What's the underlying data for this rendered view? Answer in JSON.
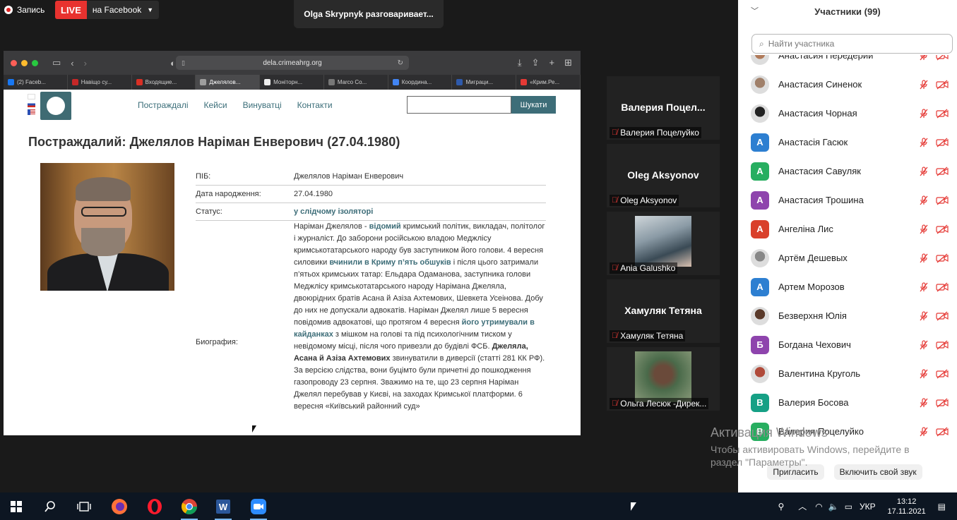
{
  "zoom": {
    "recording_label": "Запись",
    "live_label": "LIVE",
    "live_target": "на Facebook",
    "active_speaker": "Olga Skrypnyk разговаривает..."
  },
  "browser": {
    "url": "dela.crimeahrg.org",
    "tabs": [
      {
        "label": "(2) Faceb...",
        "color": "#1877f2"
      },
      {
        "label": "Навіщо су...",
        "color": "#c62828"
      },
      {
        "label": "Входящие...",
        "color": "#d93025"
      },
      {
        "label": "Джелялов...",
        "color": "#9e9e9e"
      },
      {
        "label": "Моніторн...",
        "color": "#eeeeee"
      },
      {
        "label": "Marco Co...",
        "color": "#777777"
      },
      {
        "label": "Координа...",
        "color": "#4285f4"
      },
      {
        "label": "Миграци...",
        "color": "#2e5aac"
      },
      {
        "label": "«Крим.Ре...",
        "color": "#e53935"
      }
    ]
  },
  "site": {
    "nav": [
      "Постраждалі",
      "Кейси",
      "Винуватці",
      "Контакти"
    ],
    "search_button": "Шукати",
    "heading": "Постраждалий: Джелялов Наріман Енверович (27.04.1980)",
    "fields": [
      {
        "label": "ПІБ:",
        "value": "Джелялов Наріман Енверович"
      },
      {
        "label": "Дата народження:",
        "value": "27.04.1980"
      },
      {
        "label": "Статус:",
        "value": "у слідчому ізоляторі"
      }
    ],
    "bio_label": "Биография:",
    "bio": {
      "p1": "Наріман Джелялов - ",
      "link1": "відомий",
      "p2": " кримський політик, викладач, політолог і журналіст. До заборони російською владою Меджлісу кримськотатарського народу був заступником його голови. 4 вересня силовики ",
      "link2": "вчинили в Криму п’ять обшуків",
      "p3": " і після цього затримали п’ятьох кримських татар: Ельдара Одаманова, заступника голови Меджлісу кримськотатарського народу Нарімана Джеляла, двоюрідних братів Асана й Азіза Ахтемових, Шевкета Усеінова. Добу до них не допускали адвокатів. Наріман Джелял лише 5 вересня повідомив адвокатові, що протягом 4 вересня ",
      "link3": "його утримували в кайданках",
      "p4": " з мішком на голові та під психологічним тиском у невідомому місці, після чого привезли до будівлі ФСБ. ",
      "bold1": "Джеляла, Асана й Азіза Ахтемових",
      "p5": " звинуватили в диверсії (статті 281 КК РФ). За версією слідства, вони буцімто були причетні до пошкодження газопроводу 23 серпня. Зважимо на те, що 23 серпня Наріман Джелял перебував у Києві, на заходах Кримської платформи. 6 вересня «Київський районний суд»"
    }
  },
  "tiles": [
    {
      "big": "Валерия  Поцел...",
      "tag": "Валерия Поцелуйко",
      "has_video": false
    },
    {
      "big": "Oleg Aksyonov",
      "tag": "Oleg Aksyonov",
      "has_video": false
    },
    {
      "big": "",
      "tag": "Ania Galushko",
      "has_video": true
    },
    {
      "big": "Хамуляк Тетяна",
      "tag": "Хамуляк Тетяна",
      "has_video": false
    },
    {
      "big": "",
      "tag": "Ольга Лесюк -Дирек...",
      "has_video": true
    }
  ],
  "watermark": {
    "line1": "Активация Windows",
    "line2": "Чтобы активировать Windows, перейдите в",
    "line3": "раздел \"Параметры\"."
  },
  "participants": {
    "title": "Участники (99)",
    "search_placeholder": "Найти участника",
    "items": [
      {
        "name": "Анастасия Передерий",
        "avatar": "",
        "color": "#b07a5a",
        "photo": true
      },
      {
        "name": "Анастасия Синенок",
        "avatar": "",
        "color": "#a0806a",
        "photo": true
      },
      {
        "name": "Анастасия Чорная",
        "avatar": "",
        "color": "#222222",
        "photo": true
      },
      {
        "name": "Анастасія Гасюк",
        "avatar": "А",
        "color": "#2d7fd1",
        "photo": false
      },
      {
        "name": "Анастасия Савуляк",
        "avatar": "А",
        "color": "#27ae60",
        "photo": false
      },
      {
        "name": "Анастасия Трошина",
        "avatar": "А",
        "color": "#8e44ad",
        "photo": false
      },
      {
        "name": "Ангеліна Лис",
        "avatar": "А",
        "color": "#d9402b",
        "photo": false
      },
      {
        "name": "Артём Дешевых",
        "avatar": "",
        "color": "#888888",
        "photo": true
      },
      {
        "name": "Артем Морозов",
        "avatar": "А",
        "color": "#2d7fd1",
        "photo": false
      },
      {
        "name": "Безверхня Юлія",
        "avatar": "",
        "color": "#5a3a2a",
        "photo": true
      },
      {
        "name": "Богдана Чехович",
        "avatar": "Б",
        "color": "#8e44ad",
        "photo": false
      },
      {
        "name": "Валентина Круголь",
        "avatar": "",
        "color": "#b04a3a",
        "photo": true
      },
      {
        "name": "Валерия Босова",
        "avatar": "В",
        "color": "#16a085",
        "photo": false
      },
      {
        "name": "Валерия Поцелуйко",
        "avatar": "В",
        "color": "#27ae60",
        "photo": false
      }
    ],
    "invite_button": "Пригласить",
    "unmute_button": "Включить свой звук"
  },
  "taskbar": {
    "time": "13:12",
    "date": "17.11.2021",
    "lang": "УКР"
  }
}
